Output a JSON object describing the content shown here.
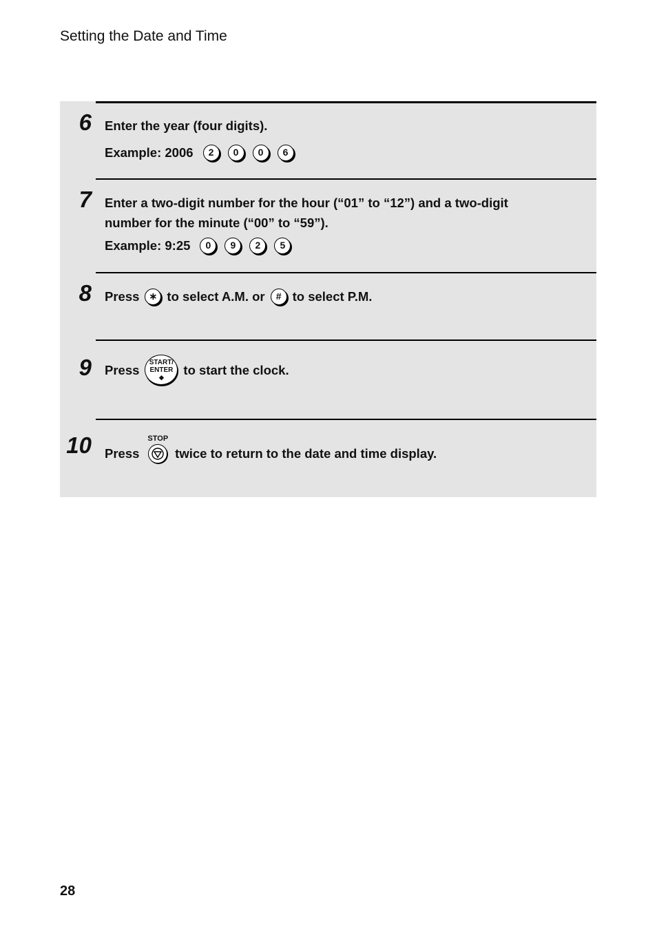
{
  "header": {
    "title": "Setting the Date and Time"
  },
  "footer": {
    "page_number": "28"
  },
  "steps": [
    {
      "number": "6",
      "lines": [
        "Enter the year (four digits)."
      ],
      "example_label": "Example: 2006",
      "keys": [
        "2",
        "0",
        "0",
        "6"
      ]
    },
    {
      "number": "7",
      "lines": [
        "Enter a two-digit number for the hour (“01” to “12”) and a two-digit",
        "number for the minute (“00” to “59”)."
      ],
      "example_label": "Example: 9:25",
      "keys": [
        "0",
        "9",
        "2",
        "5"
      ]
    },
    {
      "number": "8",
      "press": "Press",
      "key_am": "∗",
      "mid": "to select A.M. or",
      "key_pm": "#",
      "end": "to select P.M."
    },
    {
      "number": "9",
      "press": "Press",
      "key_line1": "START/",
      "key_line2": "ENTER",
      "key_symbol": "◆",
      "end": "to start the clock."
    },
    {
      "number": "10",
      "press": "Press",
      "key_label": "STOP",
      "end": "twice to return to the date and time display."
    }
  ]
}
